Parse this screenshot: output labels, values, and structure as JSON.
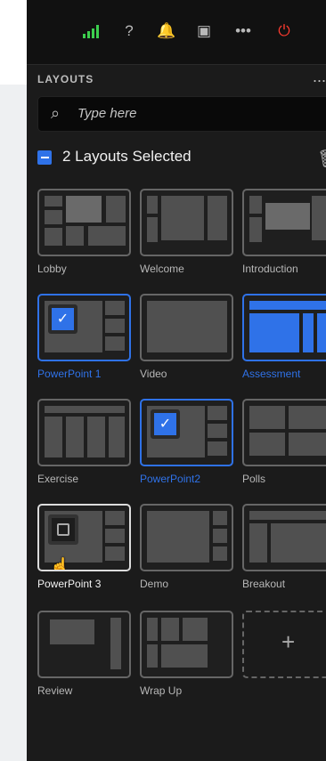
{
  "topbar": {
    "icons": [
      "signal-icon",
      "help-icon",
      "bell-icon",
      "screen-frame-icon",
      "more-icon",
      "power-icon"
    ]
  },
  "panel": {
    "title": "LAYOUTS",
    "menu": "..."
  },
  "search": {
    "placeholder": "Type here"
  },
  "selection": {
    "text": "2 Layouts Selected"
  },
  "layouts": [
    {
      "label": "Lobby",
      "selected": false
    },
    {
      "label": "Welcome",
      "selected": false
    },
    {
      "label": "Introduction",
      "selected": false
    },
    {
      "label": "PowerPoint 1",
      "selected": true
    },
    {
      "label": "Video",
      "selected": false
    },
    {
      "label": "Assessment",
      "selected": true
    },
    {
      "label": "Exercise",
      "selected": false
    },
    {
      "label": "PowerPoint2",
      "selected": true
    },
    {
      "label": "Polls",
      "selected": false
    },
    {
      "label": "PowerPoint 3",
      "selected": false
    },
    {
      "label": "Demo",
      "selected": false
    },
    {
      "label": "Breakout",
      "selected": false
    },
    {
      "label": "Review",
      "selected": false
    },
    {
      "label": "Wrap Up",
      "selected": false
    }
  ],
  "add": {
    "symbol": "+"
  },
  "colors": {
    "accent": "#2f72e8",
    "panel": "#1b1b1b",
    "power": "#ff3b2f"
  }
}
